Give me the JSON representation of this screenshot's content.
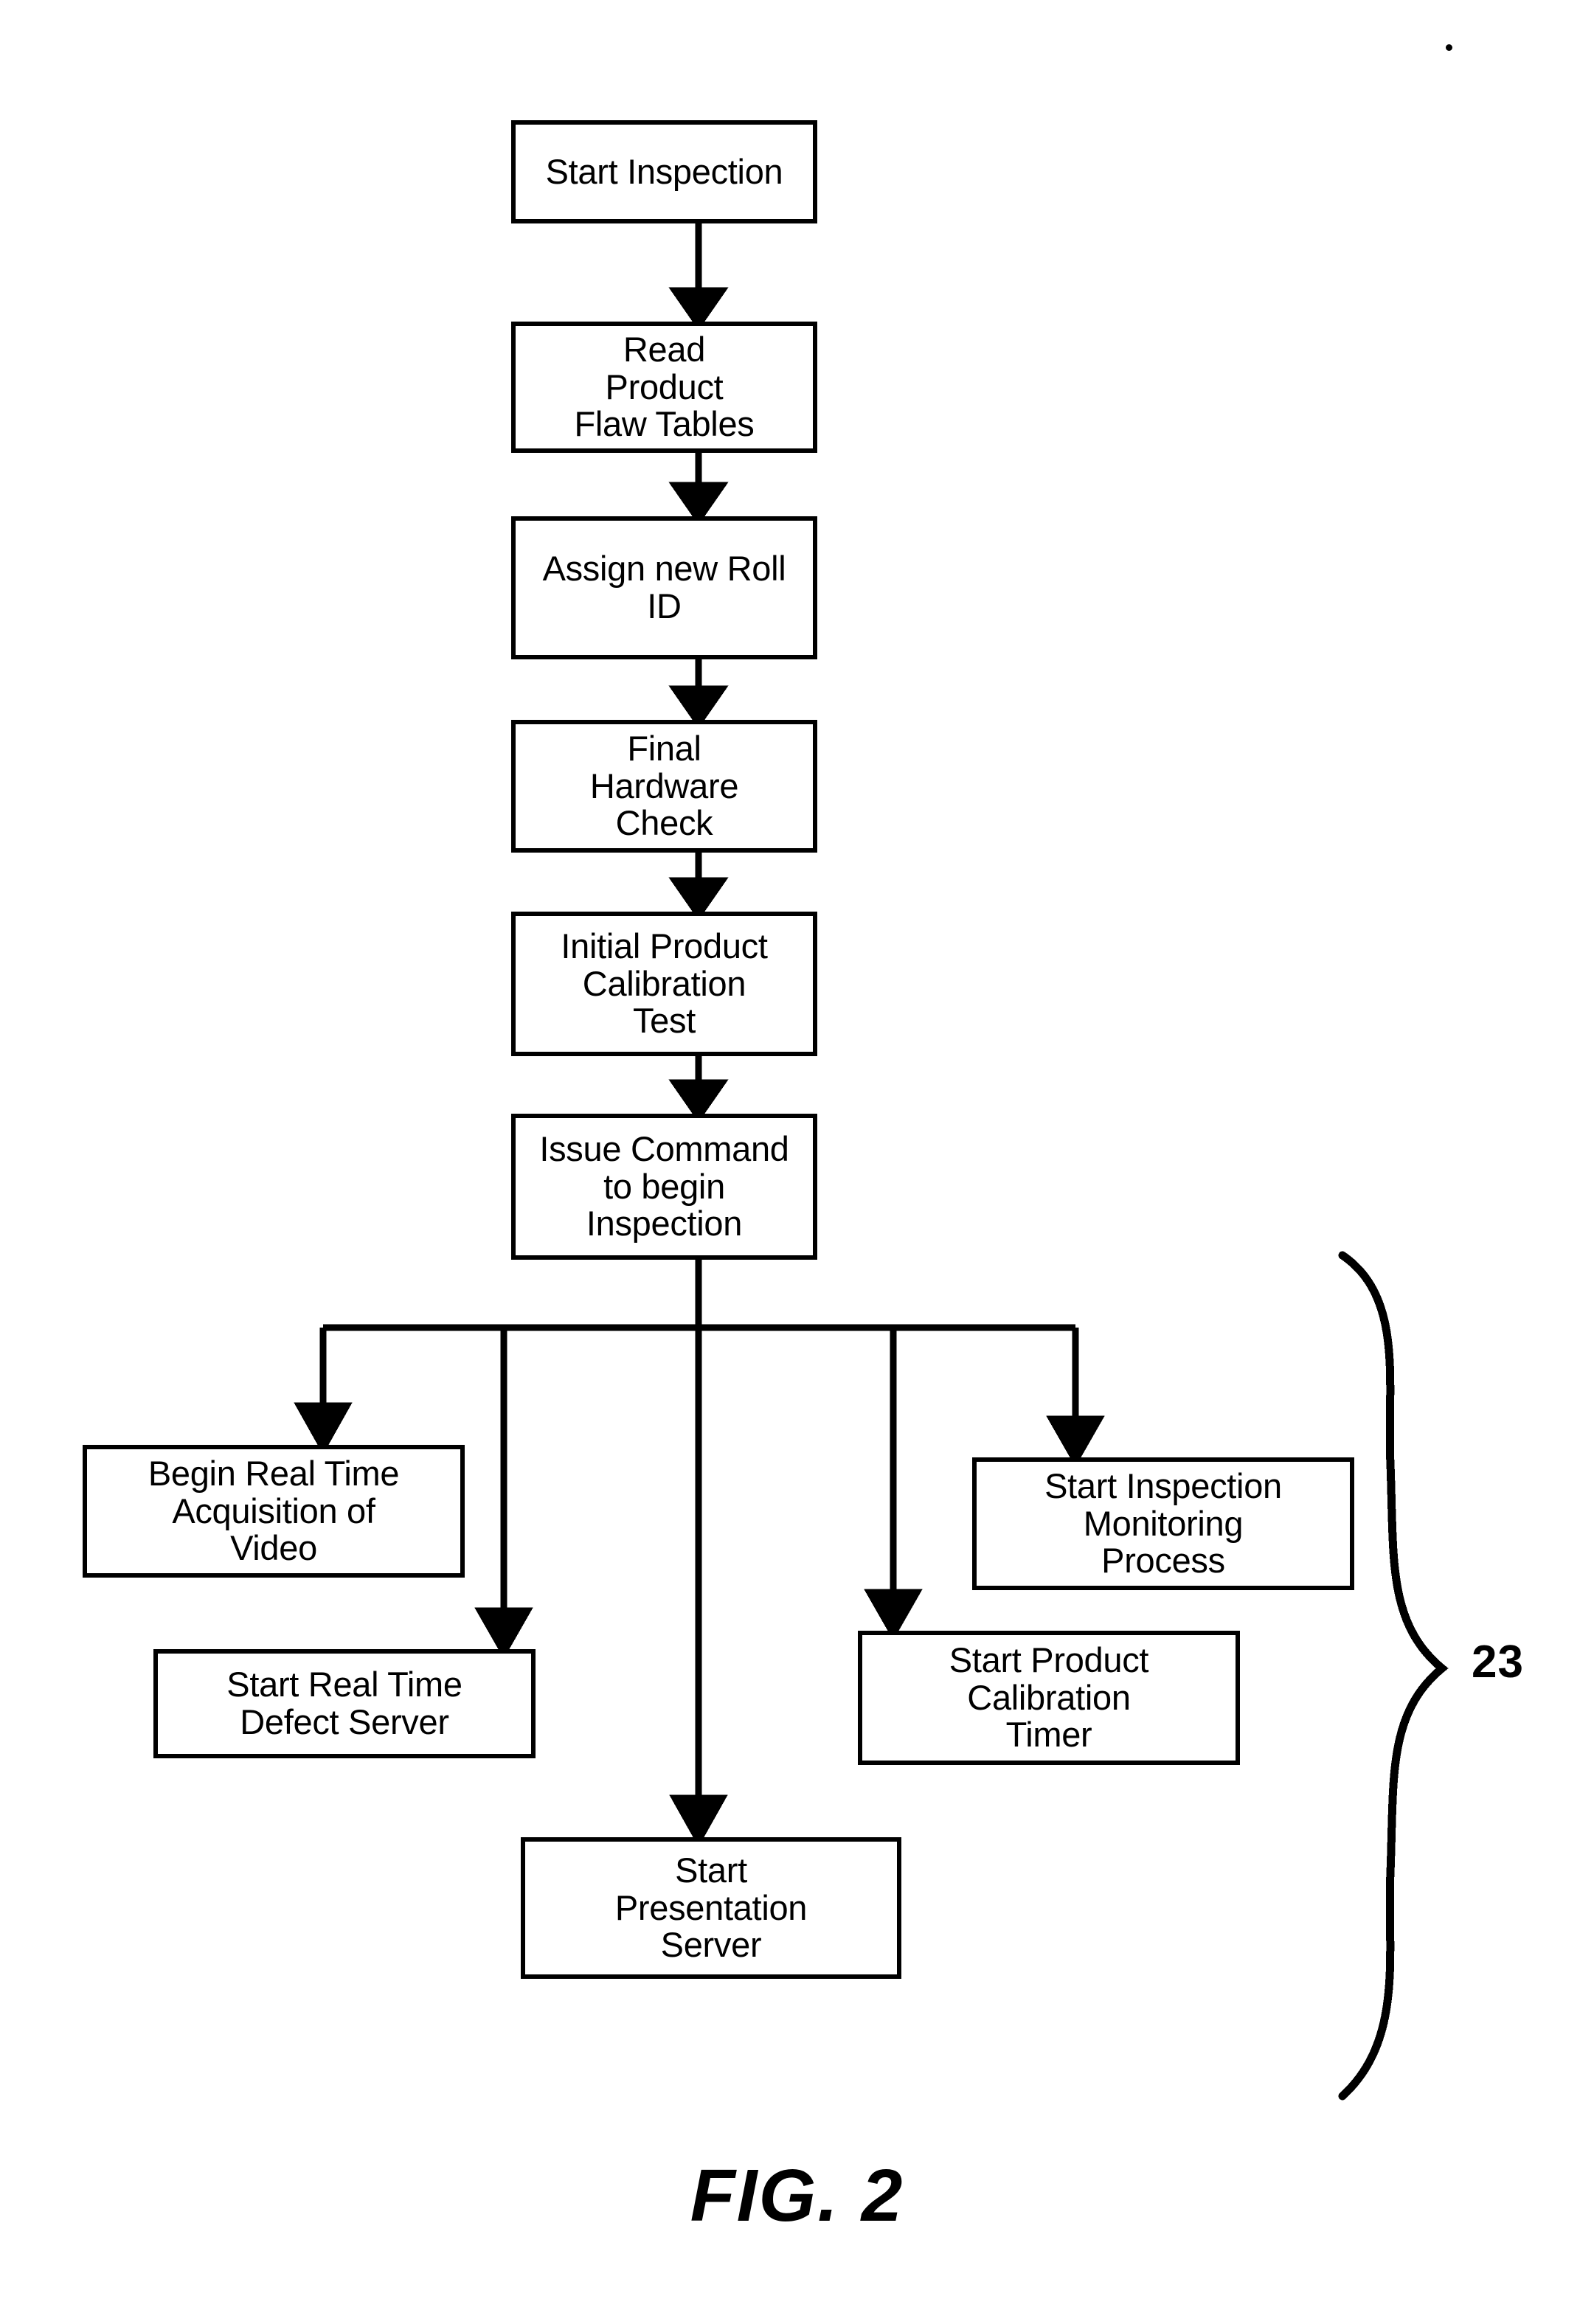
{
  "figure": {
    "caption": "FIG. 2",
    "reference_numeral": "23"
  },
  "flowchart": {
    "type": "flowchart",
    "orientation": "top-to-bottom",
    "nodes": [
      {
        "id": "start_inspection",
        "label": "Start Inspection"
      },
      {
        "id": "read_flaw_tables",
        "label": "Read\nProduct\nFlaw Tables"
      },
      {
        "id": "assign_roll_id",
        "label": "Assign new Roll\nID"
      },
      {
        "id": "final_hardware_check",
        "label": "Final\nHardware\nCheck"
      },
      {
        "id": "initial_calibration",
        "label": "Initial Product\nCalibration\nTest"
      },
      {
        "id": "issue_command",
        "label": "Issue Command\nto begin\nInspection"
      },
      {
        "id": "begin_acquisition",
        "label": "Begin Real Time\nAcquisition of\nVideo"
      },
      {
        "id": "start_defect_server",
        "label": "Start Real Time\nDefect Server"
      },
      {
        "id": "start_presentation",
        "label": "Start\nPresentation\nServer"
      },
      {
        "id": "start_calibration_timer",
        "label": "Start Product\nCalibration\nTimer"
      },
      {
        "id": "start_monitoring",
        "label": "Start Inspection\nMonitoring\nProcess"
      }
    ],
    "edges": [
      {
        "from": "start_inspection",
        "to": "read_flaw_tables"
      },
      {
        "from": "read_flaw_tables",
        "to": "assign_roll_id"
      },
      {
        "from": "assign_roll_id",
        "to": "final_hardware_check"
      },
      {
        "from": "final_hardware_check",
        "to": "initial_calibration"
      },
      {
        "from": "initial_calibration",
        "to": "issue_command"
      },
      {
        "from": "issue_command",
        "to": "begin_acquisition"
      },
      {
        "from": "issue_command",
        "to": "start_defect_server"
      },
      {
        "from": "issue_command",
        "to": "start_presentation"
      },
      {
        "from": "issue_command",
        "to": "start_calibration_timer"
      },
      {
        "from": "issue_command",
        "to": "start_monitoring"
      }
    ],
    "grouping": {
      "brace_label": "23",
      "grouped_nodes": [
        "begin_acquisition",
        "start_defect_server",
        "start_presentation",
        "start_calibration_timer",
        "start_monitoring"
      ]
    }
  },
  "colors": {
    "stroke": "#000000",
    "background": "#ffffff"
  }
}
